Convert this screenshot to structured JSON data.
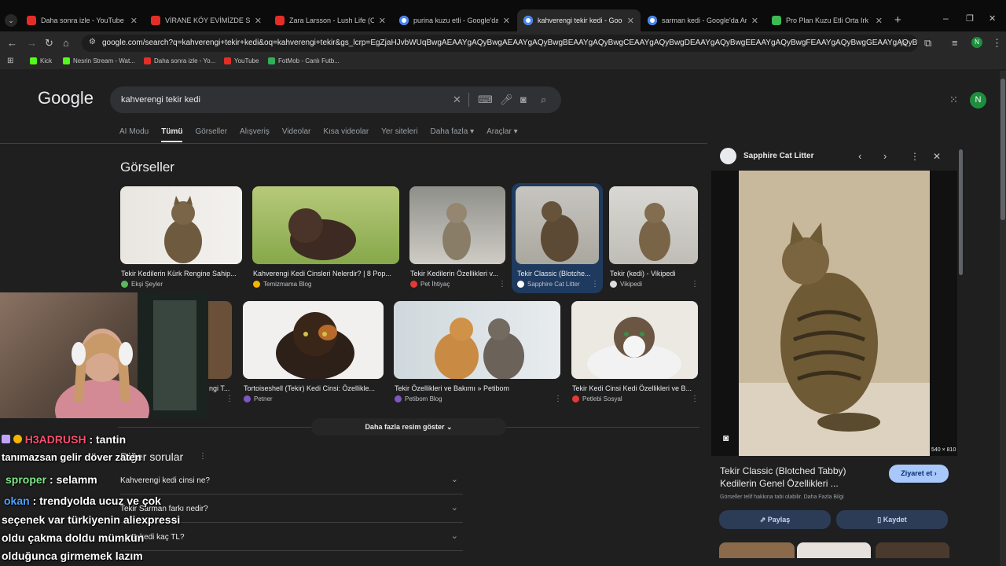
{
  "tabs": [
    {
      "label": "Daha sonra izle - YouTube",
      "icon": "youtube-icon"
    },
    {
      "label": "VİRANE KÖY EVİMİZDE SIRADIŞ",
      "icon": "youtube-icon"
    },
    {
      "label": "Zara Larsson - Lush Life (Offici",
      "icon": "youtube-icon"
    },
    {
      "label": "purina kuzu etli - Google'da Ar",
      "icon": "google-icon"
    },
    {
      "label": "kahverengi tekir kedi - Google",
      "icon": "google-icon"
    },
    {
      "label": "sarman kedi - Google'da Ara",
      "icon": "google-icon"
    },
    {
      "label": "Pro Plan Kuzu Etli Orta Irk Yetiş",
      "icon": "proplan-icon"
    }
  ],
  "url": "google.com/search?q=kahverengi+tekir+kedi&oq=kahverengi+tekir&gs_lcrp=EgZjaHJvbWUqBwgAEAAYgAQyBwgAEAAYgAQyBwgBEAAYgAQyBwgCEAAYgAQyBwgDEAAYgAQyBwgEEAAYgAQyBwgFEAAYgAQyBwgGEAAYgAQyBwgHEAAYgAQyB...",
  "bookmarks": [
    "Kick",
    "Nesrin Stream - Wat...",
    "Daha sonra izle - Yo...",
    "YouTube",
    "FotMob - Canlı Futb..."
  ],
  "profile_initial": "N",
  "logo": "Google",
  "search": {
    "query": "kahverengi tekir kedi"
  },
  "filters": [
    "AI Modu",
    "Tümü",
    "Görseller",
    "Alışveriş",
    "Videolar",
    "Kısa videolar",
    "Yer siteleri",
    "Daha fazla ▾",
    "Araçlar ▾"
  ],
  "images_title": "Görseller",
  "images_row1": [
    {
      "caption": "Tekir Kedilerin Kürk Rengine Sahip...",
      "source": "Ekşi Şeyler"
    },
    {
      "caption": "Kahverengi Kedi Cinsleri Nelerdir? | 8 Pop...",
      "source": "Temizmama Blog"
    },
    {
      "caption": "Tekir Kedilerin Özellikleri v...",
      "source": "Pet İhtiyaç"
    },
    {
      "caption": "Tekir Classic (Blotche...",
      "source": "Sapphire Cat Litter"
    },
    {
      "caption": "Tekir (kedi) - Vikipedi",
      "source": "Vikipedi"
    }
  ],
  "images_row2": [
    {
      "caption": "ngi T...",
      "source": ""
    },
    {
      "caption": "Tortoiseshell (Tekir) Kedi Cinsi: Özellikle...",
      "source": "Petner"
    },
    {
      "caption": "Tekir Özellikleri ve Bakımı » Petibom",
      "source": "Petibom Blog"
    },
    {
      "caption": "Tekir Kedi Cinsi Kedi Özellikleri ve B...",
      "source": "Petlebi Sosyal"
    }
  ],
  "more_images": "Daha fazla resim göster",
  "related_title": "Diğer sorular",
  "questions": [
    "Kahverengi kedi cinsi ne?",
    "Tekir Sarman farkı nedir?",
    "...vru kedi kaç TL?"
  ],
  "panel": {
    "source": "Sapphire Cat Litter",
    "dims": "540 × 810",
    "title_line1": "Tekir Classic (Blotched Tabby)",
    "title_line2": "Kedilerin Genel Özellikleri ...",
    "visit": "Ziyaret et",
    "license": "Görseller telif hakkına tabi olabilir. Daha Fazla Bilgi",
    "share": "Paylaş",
    "save": "Kaydet"
  },
  "chat": [
    {
      "user": "H3ADRUSH",
      "color": "#ff4d6d",
      "text": ": tantin"
    },
    {
      "user": "",
      "color": "#ffffff",
      "text": "tanımazsan gelir döver zaten"
    },
    {
      "user": "sproper",
      "color": "#7ee787",
      "text": ": selamm"
    },
    {
      "user": "okan",
      "color": "#4da3ff",
      "text": ": trendyolda ucuz ve çok"
    },
    {
      "user": "",
      "color": "#ffffff",
      "text": "seçenek var türkiyenin aliexpressi"
    },
    {
      "user": "",
      "color": "#ffffff",
      "text": "oldu çakma doldu mümkün"
    },
    {
      "user": "",
      "color": "#ffffff",
      "text": "olduğunca girmemek lazım"
    }
  ]
}
